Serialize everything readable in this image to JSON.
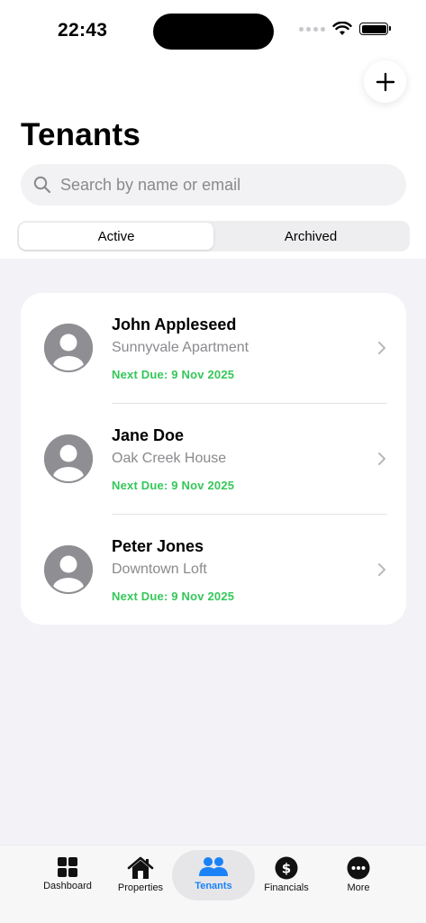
{
  "status_bar": {
    "time": "22:43"
  },
  "header": {
    "title": "Tenants",
    "add_button_icon": "plus-icon"
  },
  "search": {
    "placeholder": "Search by name or email"
  },
  "segments": [
    {
      "label": "Active",
      "selected": true
    },
    {
      "label": "Archived",
      "selected": false
    }
  ],
  "tenants": [
    {
      "name": "John Appleseed",
      "property": "Sunnyvale Apartment",
      "next_due": "Next Due: 9 Nov 2025"
    },
    {
      "name": "Jane Doe",
      "property": "Oak Creek House",
      "next_due": "Next Due: 9 Nov 2025"
    },
    {
      "name": "Peter Jones",
      "property": "Downtown Loft",
      "next_due": "Next Due: 9 Nov 2025"
    }
  ],
  "tab_bar": [
    {
      "label": "Dashboard",
      "icon": "grid-icon",
      "active": false
    },
    {
      "label": "Properties",
      "icon": "house-icon",
      "active": false
    },
    {
      "label": "Tenants",
      "icon": "people-icon",
      "active": true
    },
    {
      "label": "Financials",
      "icon": "dollar-icon",
      "active": false
    },
    {
      "label": "More",
      "icon": "more-icon",
      "active": false
    }
  ],
  "colors": {
    "accent": "#1a82f7",
    "due_green": "#34c759",
    "secondary_text": "#8a8a8e"
  }
}
